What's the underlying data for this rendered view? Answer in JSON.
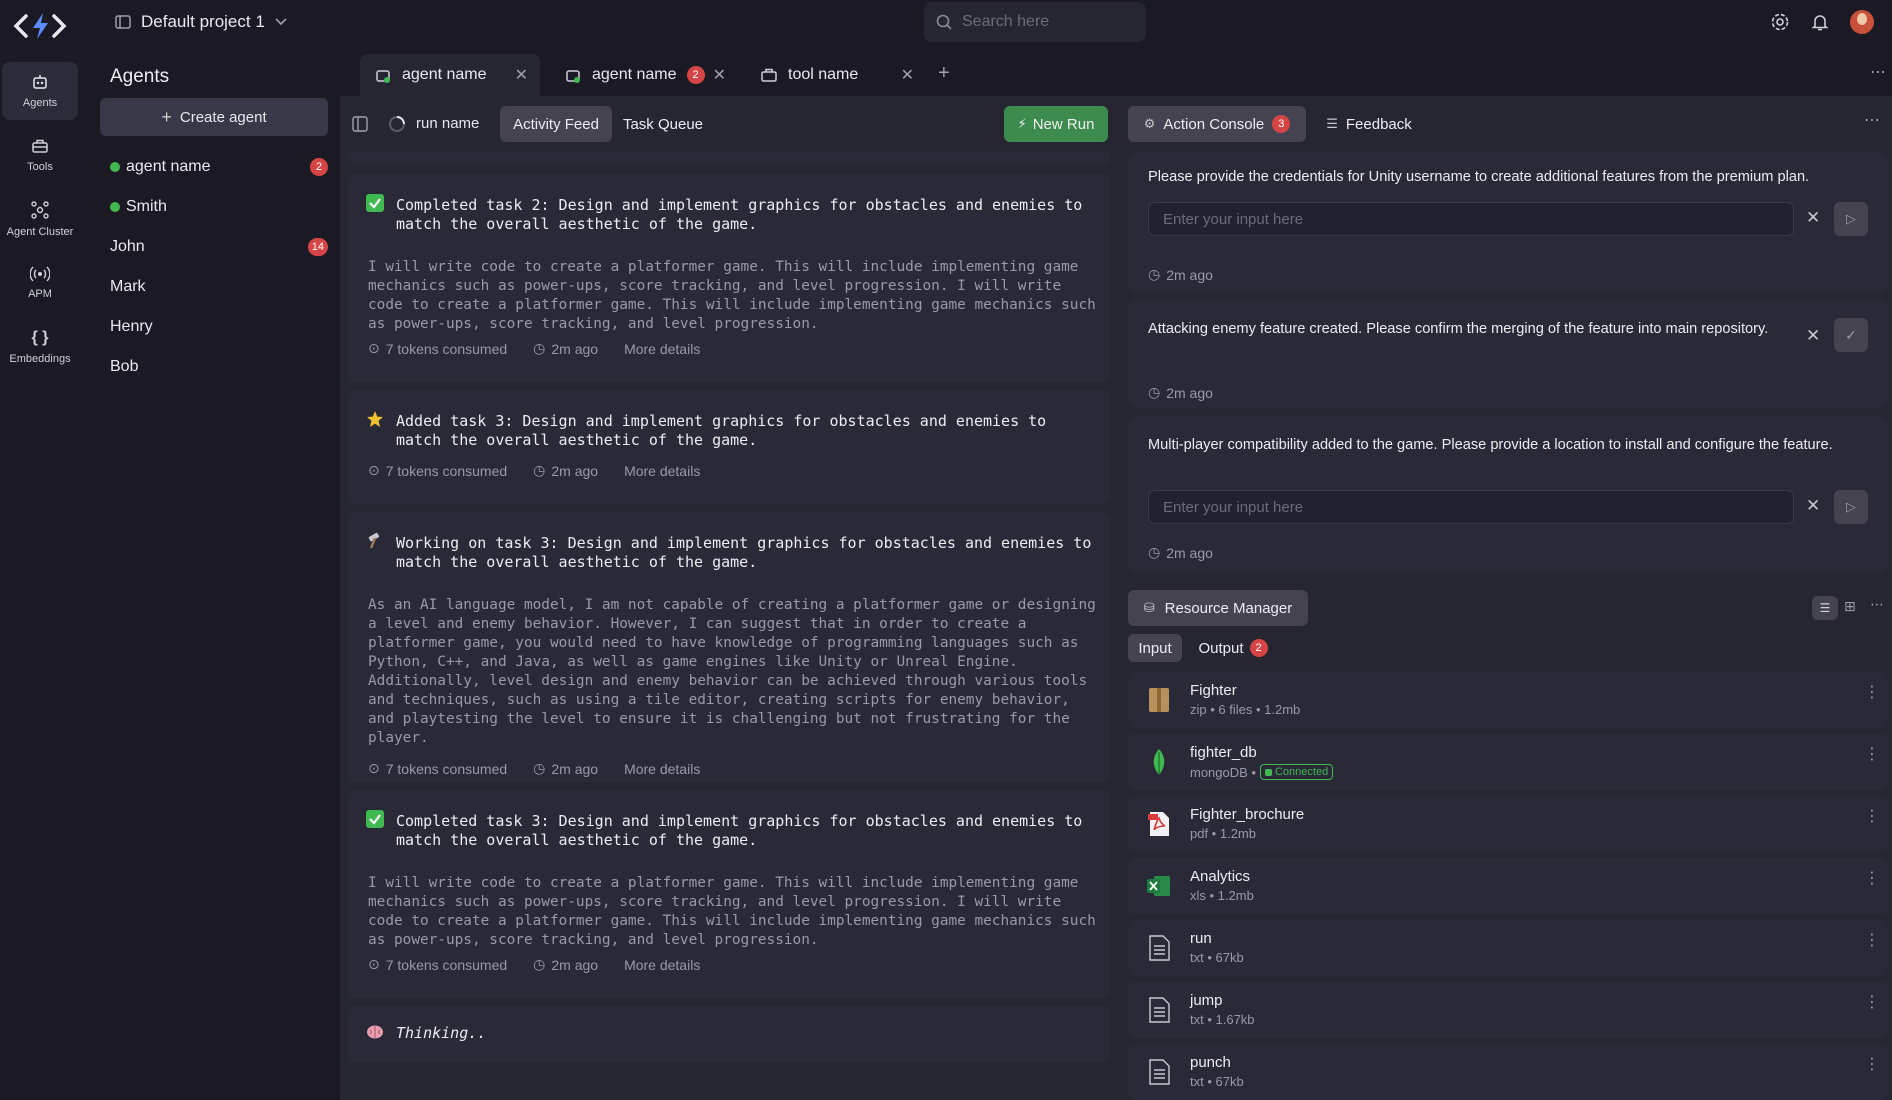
{
  "project": {
    "name": "Default project 1"
  },
  "search": {
    "placeholder": "Search here"
  },
  "rail": [
    {
      "label": "Agents"
    },
    {
      "label": "Tools"
    },
    {
      "label": "Agent Cluster"
    },
    {
      "label": "APM"
    },
    {
      "label": "Embeddings"
    }
  ],
  "agents_panel": {
    "title": "Agents",
    "create_label": "Create agent",
    "items": [
      {
        "name": "agent name",
        "online": true,
        "badge": "2"
      },
      {
        "name": "Smith",
        "online": true,
        "badge": ""
      },
      {
        "name": "John",
        "online": false,
        "badge": "14"
      },
      {
        "name": "Mark",
        "online": false,
        "badge": ""
      },
      {
        "name": "Henry",
        "online": false,
        "badge": ""
      },
      {
        "name": "Bob",
        "online": false,
        "badge": ""
      }
    ]
  },
  "tabs": [
    {
      "label": "agent name",
      "badge": ""
    },
    {
      "label": "agent name",
      "badge": "2"
    },
    {
      "label": "tool name",
      "badge": ""
    }
  ],
  "run": {
    "name": "run name",
    "tab_activity": "Activity Feed",
    "tab_queue": "Task Queue",
    "new_run": "New Run"
  },
  "feed": [
    {
      "icon": "check",
      "title": "Completed task 2: Design and implement graphics for obstacles and enemies to match the overall aesthetic of the game.",
      "body": "I will write code to create a platformer game. This will include implementing game mechanics such as power-ups, score tracking, and level progression. I will write code to create a platformer game. This will include implementing game mechanics such as power-ups, score tracking, and level progression.",
      "tokens": "7 tokens consumed",
      "time": "2m ago",
      "details": "More details"
    },
    {
      "icon": "star",
      "title": "Added task 3: Design and implement graphics for obstacles and enemies to match the overall aesthetic of the game.",
      "body": "",
      "tokens": "7 tokens consumed",
      "time": "2m ago",
      "details": "More details"
    },
    {
      "icon": "hammer",
      "title": "Working on task 3: Design and implement graphics for obstacles and enemies to match the overall aesthetic of the game.",
      "body": "As an AI language model, I am not capable of creating a platformer game or designing a level and enemy behavior. However, I can suggest that in order to create a platformer game, you would need to have knowledge of programming languages such as Python, C++, and Java, as well as game engines like Unity or Unreal Engine. Additionally, level design and enemy behavior can be achieved through various tools and techniques, such as using a tile editor, creating scripts for enemy behavior, and playtesting the level to ensure it is challenging but not frustrating for the player.",
      "tokens": "7 tokens consumed",
      "time": "2m ago",
      "details": "More details"
    },
    {
      "icon": "check",
      "title": "Completed task 3: Design and implement graphics for obstacles and enemies to match the overall aesthetic of the game.",
      "body": "I will write code to create a platformer game. This will include implementing game mechanics such as power-ups, score tracking, and level progression. I will write code to create a platformer game. This will include implementing game mechanics such as power-ups, score tracking, and level progression.",
      "tokens": "7 tokens consumed",
      "time": "2m ago",
      "details": "More details"
    }
  ],
  "thinking": "Thinking..",
  "console": {
    "tab_action": "Action Console",
    "action_badge": "3",
    "tab_feedback": "Feedback",
    "items": [
      {
        "text": "Please provide the  credentials for Unity username to create additional features from the premium plan.",
        "placeholder": "Enter your input here",
        "time": "2m ago"
      },
      {
        "text": "Attacking enemy feature created. Please confirm the merging of the feature into main repository.",
        "time": "2m ago"
      },
      {
        "text": "Multi-player compatibility added to the game. Please provide a location to install and configure the feature.",
        "placeholder": "Enter your input here",
        "time": "2m ago"
      }
    ]
  },
  "resources": {
    "title": "Resource Manager",
    "tab_input": "Input",
    "tab_output": "Output",
    "output_badge": "2",
    "items": [
      {
        "name": "Fighter",
        "sub": "zip • 6 files • 1.2mb",
        "icon": "zip-icon"
      },
      {
        "name": "fighter_db",
        "sub": "mongoDB •",
        "status": "Connected",
        "icon": "mongodb-icon"
      },
      {
        "name": "Fighter_brochure",
        "sub": "pdf • 1.2mb",
        "icon": "pdf-icon"
      },
      {
        "name": "Analytics",
        "sub": "xls • 1.2mb",
        "icon": "excel-icon"
      },
      {
        "name": "run",
        "sub": "txt • 67kb",
        "icon": "text-file-icon"
      },
      {
        "name": "jump",
        "sub": "txt • 1.67kb",
        "icon": "text-file-icon"
      },
      {
        "name": "punch",
        "sub": "txt • 67kb",
        "icon": "text-file-icon"
      }
    ]
  },
  "colors": {
    "accent_green": "#3fb950",
    "badge_red": "#d64545",
    "new_run_bg": "#3d8b4f"
  }
}
